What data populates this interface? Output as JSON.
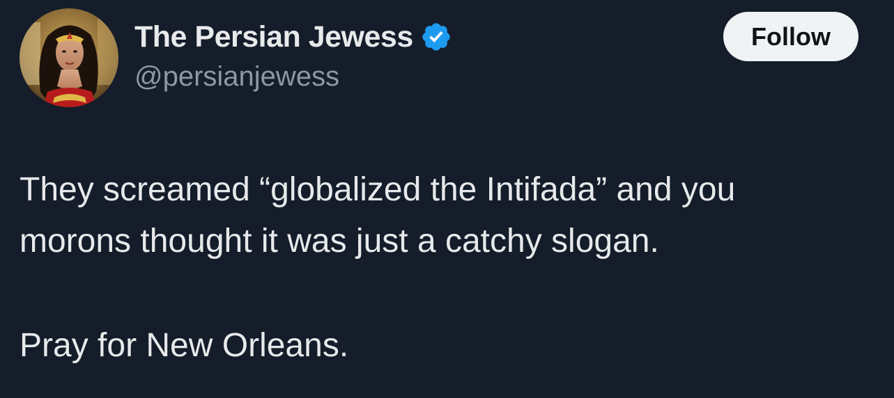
{
  "author": {
    "display_name": "The Persian Jewess",
    "handle": "@persianjewess",
    "verified": true,
    "avatar_icon": "profile-photo",
    "verified_icon": "verified-badge-icon",
    "verified_color": "#1d9bf0"
  },
  "actions": {
    "follow_label": "Follow"
  },
  "tweet": {
    "lines": [
      "They screamed “globalized the Intifada” and you",
      "morons thought it was just a catchy slogan."
    ],
    "closing_line": "Pray for New Orleans."
  },
  "theme": {
    "background": "#151d2b",
    "text": "#e7e9ea",
    "muted": "#8b98a5",
    "button_bg": "#eff3f4"
  }
}
